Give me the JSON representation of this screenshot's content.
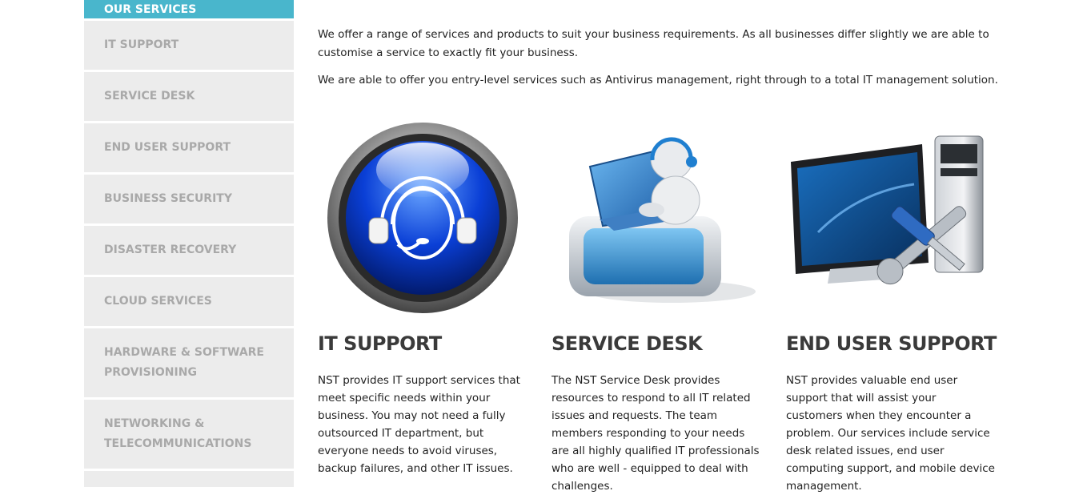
{
  "sidebar": {
    "items": [
      {
        "label": "OUR SERVICES",
        "active": true
      },
      {
        "label": "IT SUPPORT"
      },
      {
        "label": "SERVICE DESK"
      },
      {
        "label": "END USER SUPPORT"
      },
      {
        "label": "BUSINESS SECURITY"
      },
      {
        "label": "DISASTER RECOVERY"
      },
      {
        "label": "CLOUD SERVICES"
      },
      {
        "label_line1": "HARDWARE & SOFTWARE",
        "label_line2": "PROVISIONING"
      },
      {
        "label_line1": "NETWORKING &",
        "label_line2": "TELECOMMUNICATIONS"
      }
    ],
    "active_color": "#49b6cc",
    "item_color": "#ececec"
  },
  "intro": {
    "p1": "We offer a range of services and products to suit your business requirements. As all businesses differ slightly we are able to customise a service to exactly fit your business.",
    "p2": "We are able to offer you entry-level services such as Antivirus management, right through to a total IT management solution."
  },
  "services": [
    {
      "icon": "headset-icon",
      "title": "IT SUPPORT",
      "text": "NST provides IT support services that meet specific needs within your business. You may not need a fully outsourced IT department, but everyone needs to avoid viruses, backup failures, and other IT issues."
    },
    {
      "icon": "service-desk-icon",
      "title": "SERVICE DESK",
      "text": "The NST Service Desk provides resources to respond to all IT related issues and requests. The team members responding to your needs are all highly qualified IT professionals who are well - equipped to deal with challenges."
    },
    {
      "icon": "computer-tools-icon",
      "title": "END USER SUPPORT",
      "text": "NST provides valuable end user support that will assist your customers when they encounter a problem. Our services include service desk related issues, end user computing support, and mobile device management."
    }
  ]
}
